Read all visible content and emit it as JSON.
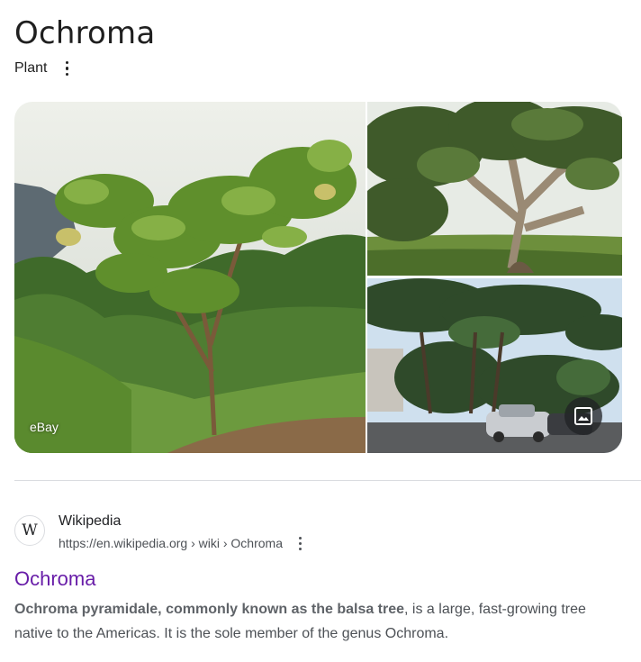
{
  "knowledge_panel": {
    "title": "Ochroma",
    "subtitle": "Plant",
    "more_icon": "more-vert-icon"
  },
  "gallery": {
    "main_image_source": "eBay",
    "images": [
      "balsa-sapling-photo",
      "balsa-tree-trunk-photo",
      "balsa-trees-parking-lot-photo"
    ],
    "more_images_icon": "image-icon"
  },
  "result": {
    "favicon": "W",
    "site_name": "Wikipedia",
    "url": "https://en.wikipedia.org › wiki › Ochroma",
    "title": "Ochroma",
    "snippet_bold": "Ochroma pyramidale, commonly known as the balsa tree",
    "snippet_rest": ", is a large, fast-growing tree native to the Americas. It is the sole member of the genus Ochroma.",
    "link_color": "#681da8"
  }
}
